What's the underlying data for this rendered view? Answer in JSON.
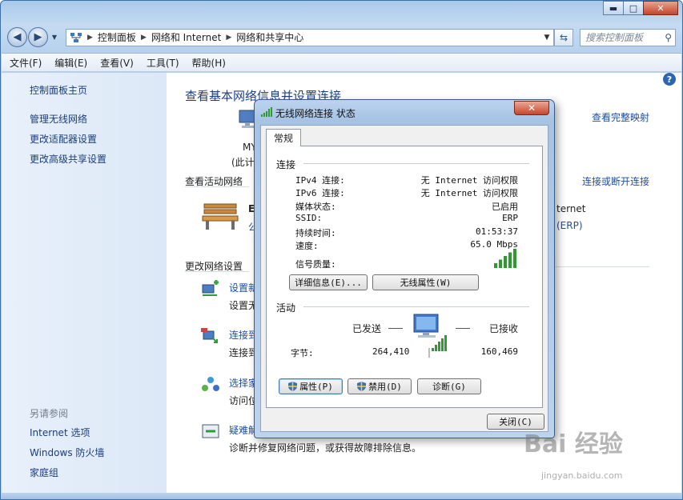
{
  "window": {
    "address": [
      "控制面板",
      "网络和 Internet",
      "网络和共享中心"
    ],
    "search_placeholder": "搜索控制面板",
    "caption": {
      "minimize": "▬",
      "maximize": "□",
      "close": "✕"
    }
  },
  "menu": [
    "文件(F)",
    "编辑(E)",
    "查看(V)",
    "工具(T)",
    "帮助(H)"
  ],
  "sidebar": {
    "home": "控制面板主页",
    "links": [
      "管理无线网络",
      "更改适配器设置",
      "更改高级共享设置"
    ],
    "see_also_label": "另请参阅",
    "see_also": [
      "Internet 选项",
      "Windows 防火墙",
      "家庭组"
    ]
  },
  "content": {
    "title": "查看基本网络信息并设置连接",
    "full_map": "查看完整映射",
    "computer_name": "MY",
    "computer_sub": "(此计",
    "active_networks": "查看活动网络",
    "connect_disconnect": "连接或断开连接",
    "network_name_partial": "E",
    "network_type_partial": "公",
    "internet_partial": "ternet",
    "erp_partial": "(ERP)",
    "change_settings": "更改网络设置",
    "tasks": [
      {
        "title": "设置新",
        "desc": "设置无"
      },
      {
        "title": "连接到",
        "desc": "连接到"
      },
      {
        "title": "选择家",
        "desc": "访问位"
      },
      {
        "title": "疑难解",
        "desc": "诊断并修复网络问题，或获得故障排除信息。"
      }
    ]
  },
  "dialog": {
    "title": "无线网络连接 状态",
    "tab": "常规",
    "connection_label": "连接",
    "connection": [
      {
        "k": "IPv4 连接:",
        "v": "无 Internet 访问权限"
      },
      {
        "k": "IPv6 连接:",
        "v": "无 Internet 访问权限"
      },
      {
        "k": "媒体状态:",
        "v": "已启用"
      },
      {
        "k": "SSID:",
        "v": "ERP"
      },
      {
        "k": "持续时间:",
        "v": "01:53:37"
      },
      {
        "k": "速度:",
        "v": "65.0 Mbps"
      }
    ],
    "signal_label": "信号质量:",
    "signal_bars": 5,
    "details_button": "详细信息(E)...",
    "wireless_props_button": "无线属性(W)",
    "activity_label": "活动",
    "sent_label": "已发送",
    "received_label": "已接收",
    "bytes_label": "字节:",
    "bytes_sent": "264,410",
    "bytes_received": "160,469",
    "properties_button": "属性(P)",
    "disable_button": "禁用(D)",
    "diagnose_button": "诊断(G)",
    "close_button": "关闭(C)"
  },
  "watermark": {
    "brand": "Bai 经验",
    "url": "jingyan.baidu.com"
  }
}
